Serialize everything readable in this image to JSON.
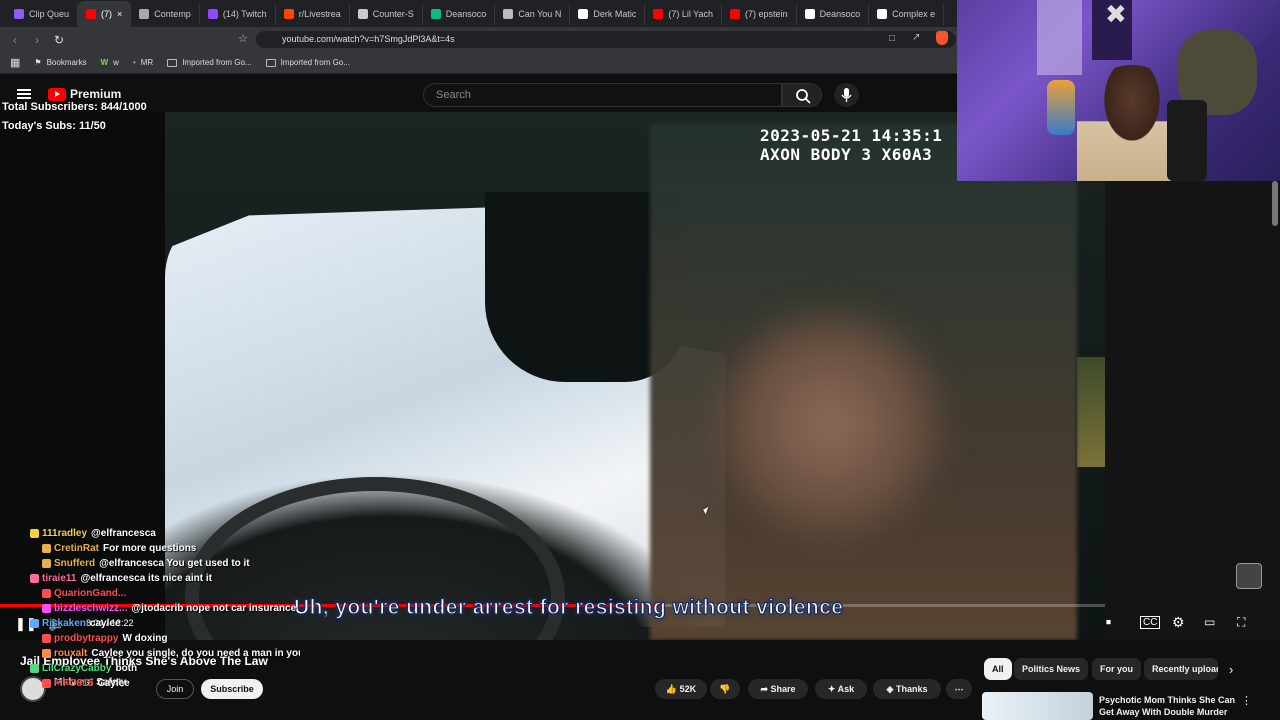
{
  "browser": {
    "tabs": [
      {
        "label": "Clip Queu",
        "color": "#8b5cf6"
      },
      {
        "label": "(7)",
        "color": "#ff0000",
        "active": true
      },
      {
        "label": "Contemp",
        "color": "#aaaaaa"
      },
      {
        "label": "(14) Twitch",
        "color": "#9146ff"
      },
      {
        "label": "r/Livestrea",
        "color": "#ff4500"
      },
      {
        "label": "Counter-S",
        "color": "#cccccc"
      },
      {
        "label": "Deansoco",
        "color": "#10b981"
      },
      {
        "label": "Can You N",
        "color": "#bbbbbb"
      },
      {
        "label": "Derk Matic",
        "color": "#ffffff"
      },
      {
        "label": "(7) Lil Yach",
        "color": "#ff0000"
      },
      {
        "label": "(7) epstein",
        "color": "#ff0000"
      },
      {
        "label": "Deansoco",
        "color": "#ffffff"
      },
      {
        "label": "Complex e",
        "color": "#ffffff"
      }
    ],
    "url": "youtube.com/watch?v=h7SmgJdPl3A&t=4s",
    "bookmarks": [
      "Bookmarks",
      "w",
      "MR",
      "Imported from Go...",
      "Imported from Go..."
    ]
  },
  "youtube": {
    "logo": "Premium",
    "search_placeholder": "Search"
  },
  "stream_overlay": {
    "total_subs": "Total Subscribers: 844/1000",
    "today_subs": "Today's Subs: 11/50"
  },
  "video": {
    "timestamp_line1": "2023-05-21 14:35:1",
    "timestamp_line2": "AXON BODY 3 X60A3",
    "subtitle": "Uh, you're under arrest for resisting without violence",
    "time": "8:04 / 13:22",
    "progress": 0.6
  },
  "chat": [
    {
      "user": "111radley",
      "msg": "@elfrancesca",
      "color": "#f5d142"
    },
    {
      "user": "CretinRat",
      "msg": "For more questions",
      "color": "#e8b04a"
    },
    {
      "user": "Snufferd",
      "msg": "@elfrancesca You get used to it",
      "color": "#e8b04a"
    },
    {
      "user": "tiraie11",
      "msg": "@elfrancesca its nice aint it",
      "color": "#ff6b9a"
    },
    {
      "user": "QuarionGand...",
      "msg": "",
      "color": "#ff4d4d"
    },
    {
      "user": "bizzleschwizz...",
      "msg": "@jtodacrib nope not car insurance",
      "color": "#ff4dff"
    },
    {
      "user": "Riskaken",
      "msg": "caylee",
      "color": "#5fa8ff"
    },
    {
      "user": "prodbytrappy",
      "msg": "W doxing",
      "color": "#ff4d4d"
    },
    {
      "user": "rouxalt",
      "msg": "Caylee you single, do you need a man in your life",
      "color": "#ff8c42"
    },
    {
      "user": "LilCrazyCabby",
      "msg": "both",
      "color": "#4ade80"
    },
    {
      "user": "FIFO915",
      "msg": "Caylee",
      "color": "#ff4d4d"
    }
  ],
  "below": {
    "title": "Jail Employee Thinks She's Above The Law",
    "channel": "Midwest Safety",
    "join": "Join",
    "subscribe": "Subscribe",
    "likes": "52K",
    "share": "Share",
    "ask": "Ask",
    "thanks": "Thanks",
    "chips": [
      "All",
      "Politics News",
      "For you",
      "Recently uploaded"
    ],
    "related_title": "Psychotic Mom Thinks She Can Get Away With Double Murder"
  }
}
